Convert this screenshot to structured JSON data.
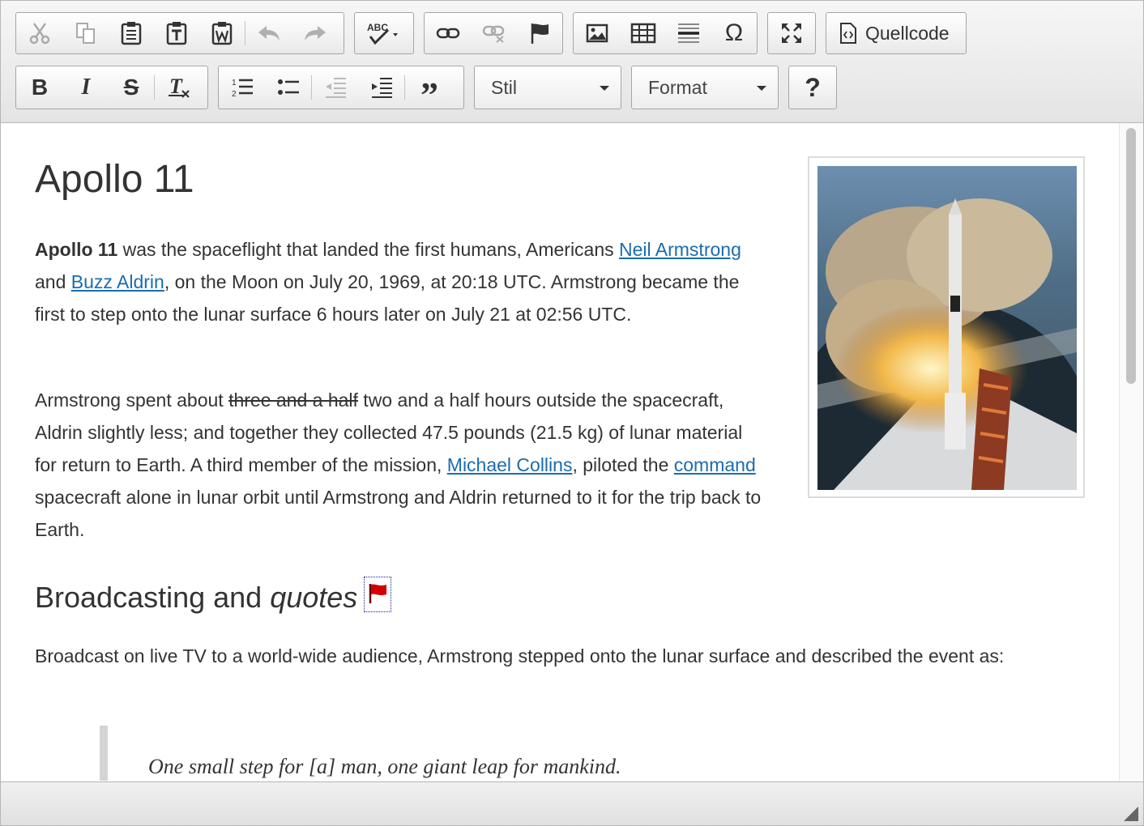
{
  "toolbar": {
    "row1": {
      "clipboard": [
        "cut",
        "copy",
        "paste",
        "paste-as-text",
        "paste-from-word"
      ],
      "history": [
        "undo",
        "redo"
      ],
      "spellcheck": "spellcheck",
      "links": [
        "link",
        "unlink",
        "anchor"
      ],
      "insert": [
        "image",
        "table",
        "horizontal-line",
        "special-character"
      ],
      "maximize": "maximize",
      "source_label": "Quellcode"
    },
    "row2": {
      "basicstyles": [
        "bold",
        "italic",
        "strikethrough",
        "remove-format"
      ],
      "lists": [
        "numbered-list",
        "bulleted-list",
        "decrease-indent",
        "increase-indent",
        "blockquote"
      ],
      "style_label": "Stil",
      "format_label": "Format",
      "help_label": "?"
    }
  },
  "content": {
    "title": "Apollo 11",
    "p1": {
      "bold": "Apollo 11",
      "t1": " was the spaceflight that landed the first humans, Americans ",
      "link1": "Neil Armstrong",
      "t2": " and ",
      "link2": "Buzz Aldrin",
      "t3": ", on the Moon on July 20, 1969, at 20:18 UTC. Armstrong became the first to step onto the lunar surface 6 hours later on July 21 at 02:56 UTC."
    },
    "p2": {
      "t1": "Armstrong spent about ",
      "strike": "three and a half",
      "t2": " two and a half hours outside the spacecraft, Aldrin slightly less; and together they collected 47.5 pounds (21.5 kg) of lunar material for return to Earth. A third member of the mission, ",
      "link1": "Michael Collins",
      "t3": ", piloted the ",
      "link2": "command",
      "t4": " spacecraft alone in lunar orbit until Armstrong and Aldrin returned to it for the trip back to Earth."
    },
    "h2": {
      "normal": "Broadcasting and ",
      "italic": "quotes"
    },
    "p3": "Broadcast on live TV to a world-wide audience, Armstrong stepped onto the lunar surface and described the event as:",
    "quote": "One small step for [a] man, one giant leap for mankind."
  },
  "colors": {
    "link": "#1a6cb0",
    "anchor_flag": "#d40000",
    "quote_border": "#d4d4d4"
  }
}
